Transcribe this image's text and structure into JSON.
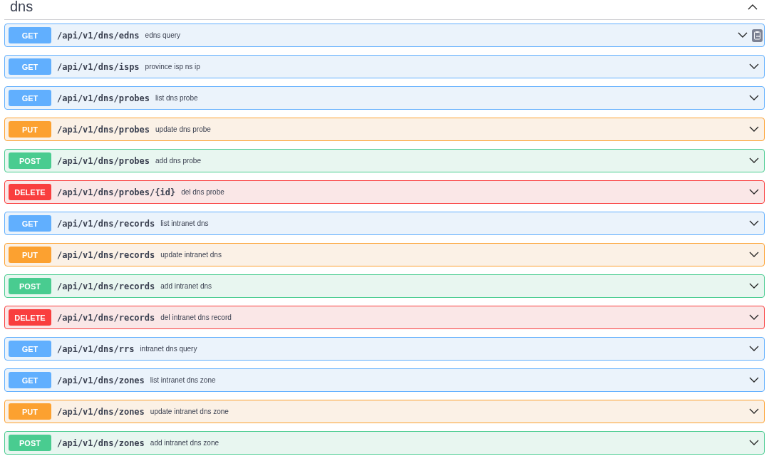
{
  "section": {
    "title": "dns",
    "expanded": true
  },
  "operations": [
    {
      "method": "GET",
      "path": "/api/v1/dns/edns",
      "summary": "edns query",
      "copy_icon": true
    },
    {
      "method": "GET",
      "path": "/api/v1/dns/isps",
      "summary": "province isp ns ip",
      "copy_icon": false
    },
    {
      "method": "GET",
      "path": "/api/v1/dns/probes",
      "summary": "list dns probe",
      "copy_icon": false
    },
    {
      "method": "PUT",
      "path": "/api/v1/dns/probes",
      "summary": "update dns probe",
      "copy_icon": false
    },
    {
      "method": "POST",
      "path": "/api/v1/dns/probes",
      "summary": "add dns probe",
      "copy_icon": false
    },
    {
      "method": "DELETE",
      "path": "/api/v1/dns/probes/{id}",
      "summary": "del dns probe",
      "copy_icon": false
    },
    {
      "method": "GET",
      "path": "/api/v1/dns/records",
      "summary": "list intranet dns",
      "copy_icon": false
    },
    {
      "method": "PUT",
      "path": "/api/v1/dns/records",
      "summary": "update intranet dns",
      "copy_icon": false
    },
    {
      "method": "POST",
      "path": "/api/v1/dns/records",
      "summary": "add intranet dns",
      "copy_icon": false
    },
    {
      "method": "DELETE",
      "path": "/api/v1/dns/records",
      "summary": "del intranet dns record",
      "copy_icon": false
    },
    {
      "method": "GET",
      "path": "/api/v1/dns/rrs",
      "summary": "intranet dns query",
      "copy_icon": false
    },
    {
      "method": "GET",
      "path": "/api/v1/dns/zones",
      "summary": "list intranet dns zone",
      "copy_icon": false
    },
    {
      "method": "PUT",
      "path": "/api/v1/dns/zones",
      "summary": "update intranet dns zone",
      "copy_icon": false
    },
    {
      "method": "POST",
      "path": "/api/v1/dns/zones",
      "summary": "add intranet dns zone",
      "copy_icon": false
    }
  ]
}
